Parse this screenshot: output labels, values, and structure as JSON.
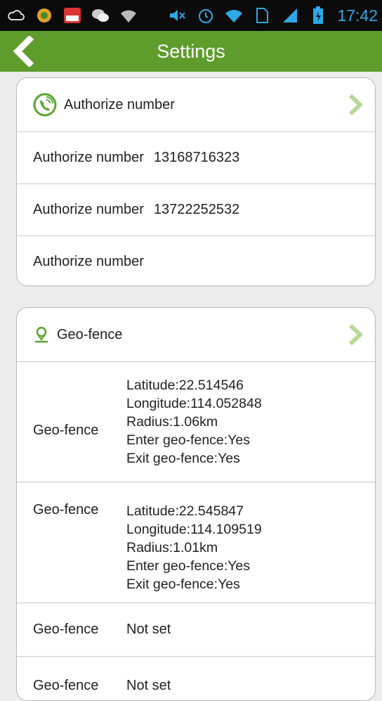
{
  "status_bar": {
    "time": "17:42",
    "left_icons": [
      "cloud-notification-icon",
      "app-icon",
      "letv-icon",
      "wechat-icon",
      "wifi-signal-icon"
    ],
    "right_icons": [
      "mute-icon",
      "alarm-icon",
      "wifi-icon",
      "sim-icon",
      "signal-icon",
      "battery-icon"
    ]
  },
  "app_bar": {
    "title": "Settings",
    "back_icon": "back-chevron-icon"
  },
  "authorize": {
    "header": "Authorize number",
    "icon": "phone-icon",
    "rows": [
      {
        "label": "Authorize number",
        "value": "13168716323"
      },
      {
        "label": "Authorize number",
        "value": "13722252532"
      },
      {
        "label": "Authorize number",
        "value": ""
      }
    ]
  },
  "geofence": {
    "header": "Geo-fence",
    "icon": "location-pin-icon",
    "rows": [
      {
        "label": "Geo-fence",
        "lines": [
          "Latitude:22.514546",
          "Longitude:114.052848",
          "Radius:1.06km",
          "Enter geo-fence:Yes",
          "Exit geo-fence:Yes"
        ]
      },
      {
        "label": "Geo-fence",
        "lines": [
          "Latitude:22.545847",
          "Longitude:114.109519",
          "Radius:1.01km",
          "Enter geo-fence:Yes",
          "Exit geo-fence:Yes"
        ]
      },
      {
        "label": "Geo-fence",
        "value": "Not set"
      },
      {
        "label": "Geo-fence",
        "value": "Not set"
      }
    ]
  },
  "colors": {
    "app_bar": "#5e9c2c",
    "status_bar": "#0b0b0b",
    "status_icons": "#2ea8e6",
    "accent_green": "#5aa433",
    "chevron": "#b8d89a"
  }
}
